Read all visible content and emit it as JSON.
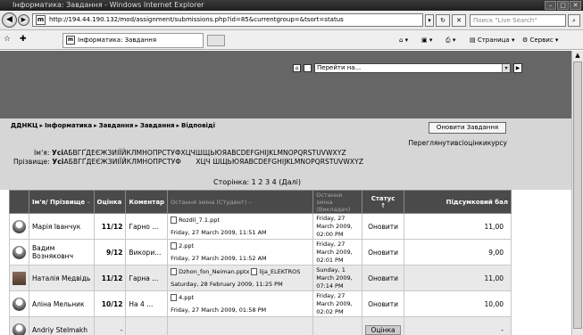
{
  "window": {
    "title": "Інформатика: Завдання - Windows Internet Explorer"
  },
  "address": {
    "url": "http://194.44.190.132/mod/assignment/submissions.php?id=85&currentgroup=&tsort=status",
    "search_placeholder": "Поиск \"Live Search\""
  },
  "tab": {
    "label": "Інформатика: Завдання"
  },
  "commands": {
    "page": "Страница",
    "service": "Сервис"
  },
  "jump": {
    "placeholder": "Перейти на..."
  },
  "breadcrumb": {
    "items": [
      "ДДНКЦ",
      "Інформатика",
      "Завдання",
      "Завдання",
      "Відповіді"
    ],
    "separator": "▸"
  },
  "update_button": "Оновити Завдання",
  "view_all_grades": "Переглянутивсіоцінкикурсу",
  "firstname_filter": {
    "label": "Ім'я:",
    "all": "Усі",
    "letters": "АБВГҐДЕЄЖЗИІЇЙКЛМНОПРСТУФХЦЧШЩЬЮЯABCDEFGHIJKLMNOPQRSTUVWXYZ"
  },
  "lastname_filter": {
    "label": "Прізвище:",
    "all": "Усі",
    "letters": "АБВГҐДЕЄЖЗИІЇЙКЛМНОПРСТУФ",
    "letters2": "ХЦЧ ШЩЬЮЯABCDEFGHIJKLMNOPQRSTUVWXYZ"
  },
  "pagination": {
    "label": "Сторінка:",
    "pages": [
      "1",
      "2",
      "3",
      "4"
    ],
    "next": "(Далі)"
  },
  "table": {
    "headers": {
      "name": "Ім'я/ Прізвище",
      "grade": "Оцінка",
      "comment": "Коментар",
      "last_student": "Остання зміна (Студент)",
      "last_teacher": "Остання зміна (Викладач)",
      "status": "Статус",
      "final": "Підсумковий бал"
    },
    "rows": [
      {
        "name": "Марія Іванчук",
        "grade": "11",
        "max": "/12",
        "comment": "Гарно ...",
        "file1": "Rozdil_7.1.ppt",
        "file2": "",
        "student_date": "Friday, 27 March 2009, 11:51 AM",
        "teacher_date": "Friday, 27 March 2009, 02:00 PM",
        "status": "Оновити",
        "final": "11,00"
      },
      {
        "name": "Вадим Возняковнч",
        "grade": "9",
        "max": "/12",
        "comment": "Викори...",
        "file1": "2.ppt",
        "file2": "",
        "student_date": "Friday, 27 March 2009, 11:52 AM",
        "teacher_date": "Friday, 27 March 2009, 02:01 PM",
        "status": "Оновити",
        "final": "9,00"
      },
      {
        "name": "Наталія Медвідь",
        "grade": "11",
        "max": "/12",
        "comment": "Гарна ...",
        "file1": "Dzhon_fon_Neiman.pptx",
        "file2": "lija_ELEKTROS",
        "student_date": "Saturday, 28 February 2009, 11:25 PM",
        "teacher_date": "Sunday, 1 March 2009, 07:14 PM",
        "status": "Оновити",
        "final": "11,00"
      },
      {
        "name": "Аліна Мельник",
        "grade": "10",
        "max": "/12",
        "comment": "На 4 ...",
        "file1": "4.ppt",
        "file2": "",
        "student_date": "Friday, 27 March 2009, 01:58 PM",
        "teacher_date": "Friday, 27 March 2009, 02:02 PM",
        "status": "Оновити",
        "final": "10,00"
      },
      {
        "name": "Andriy Stelmakh",
        "grade": "-",
        "max": "",
        "comment": "",
        "file1": "",
        "file2": "",
        "student_date": "",
        "teacher_date": "",
        "status": "Оцінка",
        "final": "-"
      }
    ]
  },
  "colors": {
    "banner": "#666666",
    "navband": "#d6d6d6",
    "header": "#4a4a4a"
  }
}
